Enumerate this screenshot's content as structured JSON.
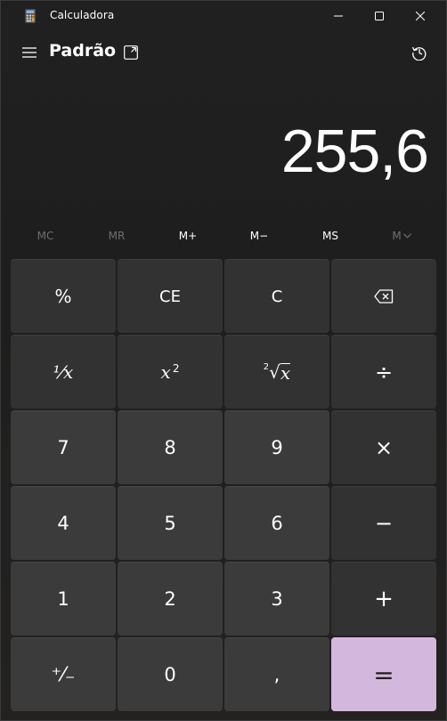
{
  "window": {
    "title": "Calculadora",
    "controls": {
      "minimize": "minimize-icon",
      "maximize": "maximize-icon",
      "close": "close-icon"
    }
  },
  "header": {
    "menu_icon": "hamburger-icon",
    "mode_title": "Padrão",
    "keep_on_top_icon": "keep-on-top-icon",
    "history_icon": "history-icon"
  },
  "display": {
    "value": "255,6"
  },
  "memory": {
    "buttons": [
      {
        "label": "MC",
        "enabled": false
      },
      {
        "label": "MR",
        "enabled": false
      },
      {
        "label": "M+",
        "enabled": true
      },
      {
        "label": "M−",
        "enabled": true
      },
      {
        "label": "MS",
        "enabled": true
      },
      {
        "label": "M",
        "enabled": false
      }
    ]
  },
  "keys": {
    "percent": "%",
    "ce": "CE",
    "clear": "C",
    "backspace_icon": "backspace-icon",
    "reciprocal": "¹⁄x",
    "square_base": "x",
    "square_exp": "2",
    "sqrt_index": "2",
    "sqrt_radicand": "x",
    "divide": "÷",
    "seven": "7",
    "eight": "8",
    "nine": "9",
    "multiply": "×",
    "four": "4",
    "five": "5",
    "six": "6",
    "minus": "−",
    "one": "1",
    "two": "2",
    "three": "3",
    "plus": "+",
    "negate": "⁺⁄₋",
    "zero": "0",
    "decimal": ",",
    "equals": "="
  },
  "colors": {
    "background": "#1f1f1f",
    "function_key": "#323232",
    "number_key": "#3b3b3b",
    "accent_equals": "#d4b7dc"
  }
}
